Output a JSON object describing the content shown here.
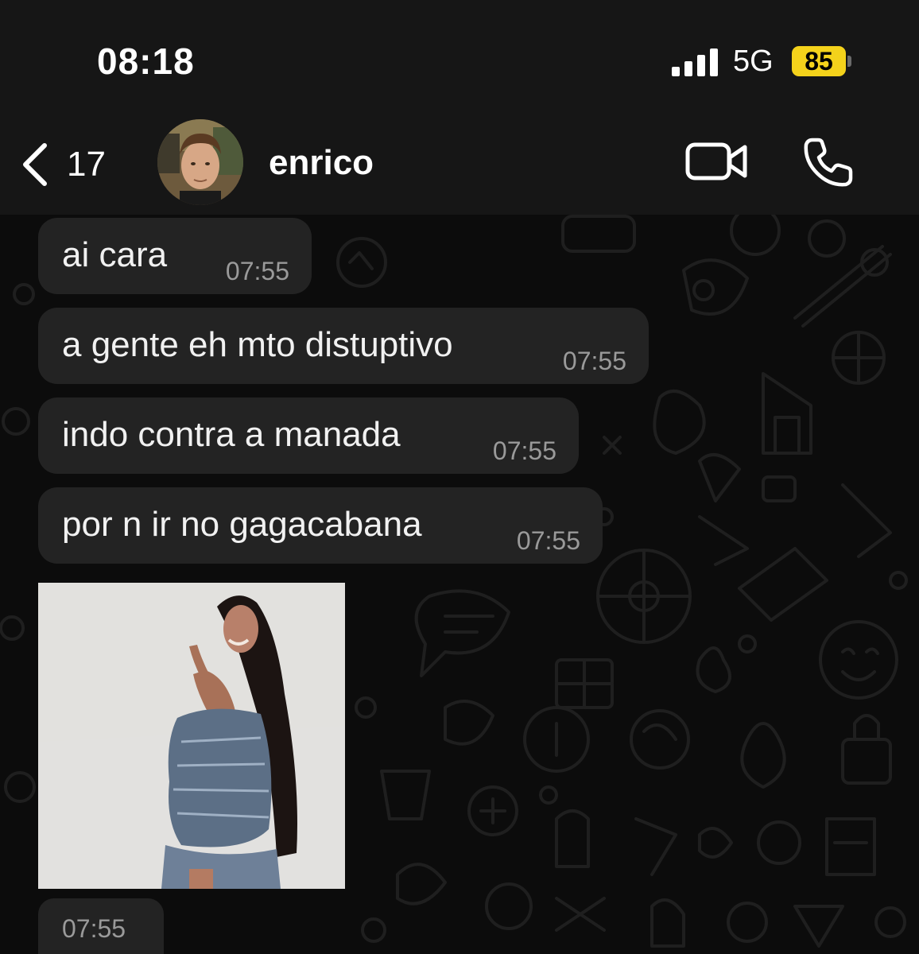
{
  "status_bar": {
    "time": "08:18",
    "network": "5G",
    "battery_level": "85",
    "battery_color": "#f4d21b"
  },
  "header": {
    "back_count": "17",
    "contact_name": "enrico",
    "back_icon": "chevron-left-icon",
    "video_icon": "video-camera-icon",
    "call_icon": "phone-icon"
  },
  "messages": [
    {
      "text": "ai cara",
      "time": "07:55"
    },
    {
      "text": "a gente eh mto distuptivo",
      "time": "07:55"
    },
    {
      "text": "indo contra a manada",
      "time": "07:55"
    },
    {
      "text": "por n ir no gagacabana",
      "time": "07:55"
    }
  ],
  "media_message": {
    "type": "photo",
    "time": "07:55"
  },
  "colors": {
    "bubble": "#232323",
    "header": "#161616",
    "background": "#0b0b0b"
  }
}
